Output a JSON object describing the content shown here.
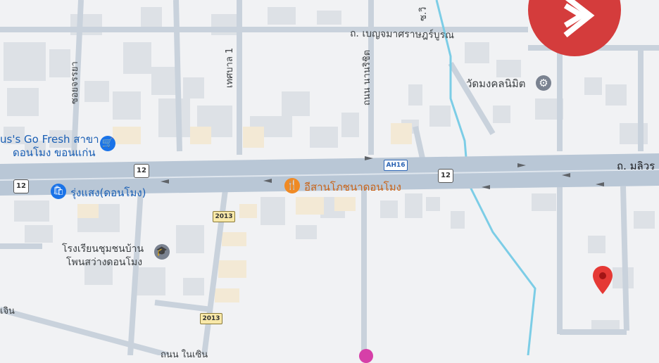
{
  "roads": {
    "main_highway": "ถ. มลิวร",
    "north_road": "ถ. เบญจมาศราษฎร์บูรณ",
    "thesaban_1": "เทศบาล 1",
    "nanarit": "ถนน นานริชิต",
    "vertical_left": "ซอยจรรยา",
    "bottom_left": "เจิน",
    "bottom_center": "ถนน ในเซิน",
    "top_small": "ซ.วิ"
  },
  "shields": {
    "ah": "AH16",
    "route_12": "12",
    "route_2013": "2013"
  },
  "pois": {
    "temple": "วัดมงคลนิมิต",
    "shop_line1": "us's Go Fresh สาขา",
    "shop_line2": "ดอนโมง ขอนแก่น",
    "store": "รุ่งแสง(ดอนโมง)",
    "restaurant": "อีสานโภชนาดอนโมง",
    "school_line1": "โรงเรียนชุมชนบ้าน",
    "school_line2": "โพนสว่างดอนโมง"
  },
  "colors": {
    "background": "#f1f2f4",
    "road_main": "#b9c7d6",
    "road_minor": "#c9d2dc",
    "building": "#dde1e6",
    "building_warm": "#f3e9d5",
    "river": "#7ccde6",
    "restaurant": "#f08a24",
    "shop_blue": "#1a73e8",
    "pin": "#e53935",
    "logo": "#d43c3c"
  },
  "icons": {
    "temple": "dharma-wheel-icon",
    "shop": "shopping-cart-icon",
    "store": "shopping-bag-icon",
    "restaurant": "fork-knife-icon",
    "school": "graduation-cap-icon",
    "pin": "location-pin-icon",
    "logo": "brand-logo-icon"
  }
}
